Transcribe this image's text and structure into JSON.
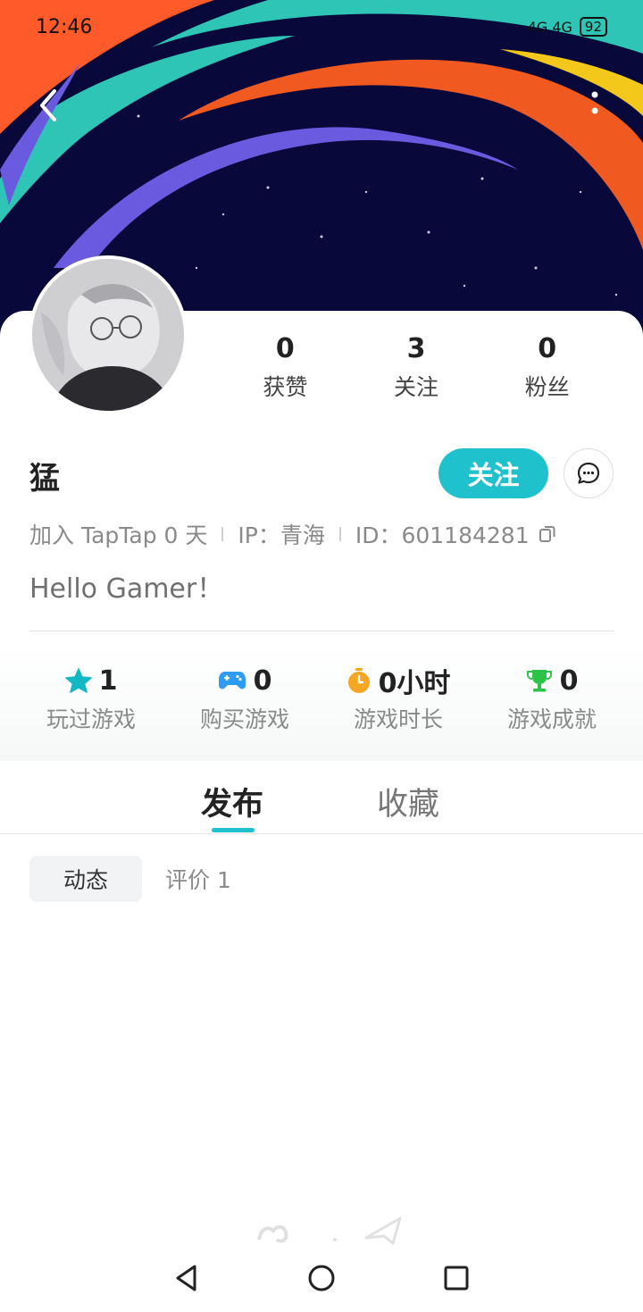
{
  "status_bar": {
    "time": "12:46",
    "signal": "4G 4G",
    "battery": "92"
  },
  "profile": {
    "name": "猛",
    "stats": [
      {
        "value": "0",
        "label": "获赞"
      },
      {
        "value": "3",
        "label": "关注"
      },
      {
        "value": "0",
        "label": "粉丝"
      }
    ],
    "follow_label": "关注",
    "joined": "加入 TapTap 0 天",
    "ip": "IP：青海",
    "id": "ID：601184281",
    "bio": "Hello Gamer！"
  },
  "game_stats": [
    {
      "value": "1",
      "label": "玩过游戏",
      "icon": "star-icon",
      "color": "#14b8c4"
    },
    {
      "value": "0",
      "label": "购买游戏",
      "icon": "gamepad-icon",
      "color": "#2d9cf2"
    },
    {
      "value": "0小时",
      "label": "游戏时长",
      "icon": "stopwatch-icon",
      "color": "#f5a623"
    },
    {
      "value": "0",
      "label": "游戏成就",
      "icon": "trophy-icon",
      "color": "#2dc34a"
    }
  ],
  "tabs": {
    "publish": "发布",
    "favorites": "收藏"
  },
  "subtabs": {
    "moments": "动态",
    "reviews": "评价 1"
  },
  "colors": {
    "accent": "#1fc2cc",
    "banner_bg": "#0a0a3c"
  }
}
